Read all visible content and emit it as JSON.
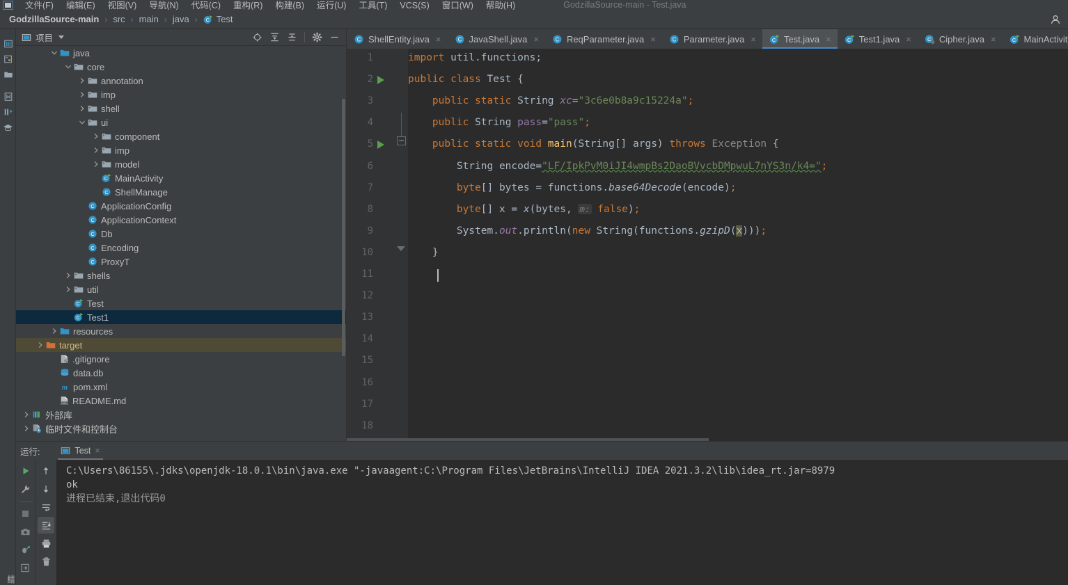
{
  "window": {
    "title": "GodzillaSource-main - Test.java"
  },
  "menubar": {
    "items": [
      "文件(F)",
      "编辑(E)",
      "视图(V)",
      "导航(N)",
      "代码(C)",
      "重构(R)",
      "构建(B)",
      "运行(U)",
      "工具(T)",
      "VCS(S)",
      "窗口(W)",
      "帮助(H)"
    ]
  },
  "breadcrumb": {
    "root": "GodzillaSource-main",
    "items": [
      "src",
      "main",
      "java",
      "Test"
    ],
    "separator": "›"
  },
  "rail": {
    "icons": [
      "project-icon",
      "structure-icon",
      "folder-icon",
      "favorites-icon",
      "build-icon",
      "learn-icon"
    ],
    "vertical_label": "结"
  },
  "project_panel": {
    "title": "项目",
    "toolbar": [
      "locate-icon",
      "expand-all-icon",
      "collapse-all-icon",
      "gear-icon",
      "minimize-icon"
    ],
    "tree": [
      {
        "label": "java",
        "indent": 4,
        "arrow": "down",
        "icon": "folder-source",
        "type": "folder"
      },
      {
        "label": "core",
        "indent": 5,
        "arrow": "down",
        "icon": "folder-pkg",
        "type": "folder"
      },
      {
        "label": "annotation",
        "indent": 6,
        "arrow": "right",
        "icon": "folder-pkg",
        "type": "folder"
      },
      {
        "label": "imp",
        "indent": 6,
        "arrow": "right",
        "icon": "folder-pkg",
        "type": "folder"
      },
      {
        "label": "shell",
        "indent": 6,
        "arrow": "right",
        "icon": "folder-pkg",
        "type": "folder"
      },
      {
        "label": "ui",
        "indent": 6,
        "arrow": "down",
        "icon": "folder-pkg",
        "type": "folder"
      },
      {
        "label": "component",
        "indent": 7,
        "arrow": "right",
        "icon": "folder-pkg",
        "type": "folder"
      },
      {
        "label": "imp",
        "indent": 7,
        "arrow": "right",
        "icon": "folder-pkg",
        "type": "folder"
      },
      {
        "label": "model",
        "indent": 7,
        "arrow": "right",
        "icon": "folder-pkg",
        "type": "folder"
      },
      {
        "label": "MainActivity",
        "indent": 7,
        "arrow": "none",
        "icon": "class-run",
        "type": "class"
      },
      {
        "label": "ShellManage",
        "indent": 7,
        "arrow": "none",
        "icon": "class",
        "type": "class"
      },
      {
        "label": "ApplicationConfig",
        "indent": 6,
        "arrow": "none",
        "icon": "class",
        "type": "class"
      },
      {
        "label": "ApplicationContext",
        "indent": 6,
        "arrow": "none",
        "icon": "class",
        "type": "class"
      },
      {
        "label": "Db",
        "indent": 6,
        "arrow": "none",
        "icon": "class",
        "type": "class"
      },
      {
        "label": "Encoding",
        "indent": 6,
        "arrow": "none",
        "icon": "class",
        "type": "class"
      },
      {
        "label": "ProxyT",
        "indent": 6,
        "arrow": "none",
        "icon": "class",
        "type": "class"
      },
      {
        "label": "shells",
        "indent": 5,
        "arrow": "right",
        "icon": "folder-pkg",
        "type": "folder"
      },
      {
        "label": "util",
        "indent": 5,
        "arrow": "right",
        "icon": "folder-pkg",
        "type": "folder"
      },
      {
        "label": "Test",
        "indent": 5,
        "arrow": "none",
        "icon": "class-run",
        "type": "class"
      },
      {
        "label": "Test1",
        "indent": 5,
        "arrow": "none",
        "icon": "class-run",
        "type": "class",
        "state": "selected"
      },
      {
        "label": "resources",
        "indent": 4,
        "arrow": "right",
        "icon": "folder-source",
        "type": "folder"
      },
      {
        "label": "target",
        "indent": 3,
        "arrow": "right",
        "icon": "folder-target",
        "type": "folder",
        "state": "target"
      },
      {
        "label": ".gitignore",
        "indent": 4,
        "arrow": "none",
        "icon": "gitignore",
        "type": "file"
      },
      {
        "label": "data.db",
        "indent": 4,
        "arrow": "none",
        "icon": "database",
        "type": "file"
      },
      {
        "label": "pom.xml",
        "indent": 4,
        "arrow": "none",
        "icon": "maven",
        "type": "file"
      },
      {
        "label": "README.md",
        "indent": 4,
        "arrow": "none",
        "icon": "markdown",
        "type": "file"
      },
      {
        "label": "外部库",
        "indent": 2,
        "arrow": "right",
        "icon": "libraries",
        "type": "node"
      },
      {
        "label": "临时文件和控制台",
        "indent": 2,
        "arrow": "right",
        "icon": "scratches",
        "type": "node"
      }
    ]
  },
  "editor_tabs": [
    {
      "label": "ShellEntity.java",
      "icon": "java-class",
      "active": false,
      "close": "×"
    },
    {
      "label": "JavaShell.java",
      "icon": "java-class",
      "active": false,
      "close": "×"
    },
    {
      "label": "ReqParameter.java",
      "icon": "java-class",
      "active": false,
      "close": "×"
    },
    {
      "label": "Parameter.java",
      "icon": "java-class",
      "active": false,
      "close": "×"
    },
    {
      "label": "Test.java",
      "icon": "java-runnable",
      "active": true,
      "close": "×"
    },
    {
      "label": "Test1.java",
      "icon": "java-runnable",
      "active": false,
      "close": "×"
    },
    {
      "label": "Cipher.java",
      "icon": "java-class-q",
      "active": false,
      "close": "×"
    },
    {
      "label": "MainActivity.java",
      "icon": "java-runnable",
      "active": false,
      "close": "×"
    }
  ],
  "editor": {
    "line_numbers": [
      "1",
      "2",
      "3",
      "4",
      "5",
      "6",
      "7",
      "8",
      "9",
      "10",
      "11",
      "12",
      "13",
      "14",
      "15",
      "16",
      "17",
      "18"
    ],
    "lines": [
      {
        "n": 1,
        "text": "import util.functions;"
      },
      {
        "n": 2,
        "text": "public class Test {",
        "run_marker": true
      },
      {
        "n": 3,
        "text": "    public static String xc=\"3c6e0b8a9c15224a\";"
      },
      {
        "n": 4,
        "text": "    public String pass=\"pass\";"
      },
      {
        "n": 5,
        "text": "    public static void main(String[] args) throws Exception {",
        "run_marker": true
      },
      {
        "n": 6,
        "text": "        String encode=\"LF/IpkPvM0iJI4wmpBs2DaoBVvcbDMpwuL7nYS3n/k4=\";"
      },
      {
        "n": 7,
        "text": "        byte[] bytes = functions.base64Decode(encode);"
      },
      {
        "n": 8,
        "text": "        byte[] x = x(bytes,  m: false);"
      },
      {
        "n": 9,
        "text": "        System.out.println(new String(functions.gzipD(x)));"
      },
      {
        "n": 10,
        "text": "    }"
      },
      {
        "n": 11,
        "text": ""
      },
      {
        "n": 12,
        "text": ""
      },
      {
        "n": 13,
        "text": ""
      },
      {
        "n": 14,
        "text": ""
      },
      {
        "n": 15,
        "text": ""
      },
      {
        "n": 16,
        "text": ""
      },
      {
        "n": 17,
        "text": ""
      },
      {
        "n": 18,
        "text": ""
      }
    ],
    "strings": {
      "xc_value": "3c6e0b8a9c15224a",
      "pass_value": "pass",
      "encode_value": "LF/IpkPvM0iJI4wmpBs2DaoBVvcbDMpwuL7nYS3n/k4=",
      "param_hint": "m:"
    }
  },
  "run_panel": {
    "label": "运行:",
    "tab": "Test",
    "tab_close": "×",
    "left_buttons": [
      "rerun-icon",
      "wrench-icon",
      "stop-icon",
      "camera-icon",
      "bug-icon",
      "export-icon"
    ],
    "right_buttons": [
      "up-arrow-icon",
      "down-arrow-icon",
      "soft-wrap-icon",
      "scroll-to-end-icon",
      "print-icon",
      "trash-icon"
    ],
    "vertical_label": "结",
    "console": [
      "C:\\Users\\86155\\.jdks\\openjdk-18.0.1\\bin\\java.exe \"-javaagent:C:\\Program Files\\JetBrains\\IntelliJ IDEA 2021.3.2\\lib\\idea_rt.jar=8979",
      "ok",
      "",
      "进程已结束,退出代码0"
    ]
  },
  "colors": {
    "bg": "#3c3f41",
    "editor_bg": "#2b2b2b",
    "accent": "#4a88c7",
    "keyword": "#cc7832",
    "string": "#6a8759",
    "field": "#9876aa",
    "method": "#ffc66d",
    "selection": "#0d293e",
    "target_folder": "#4e4a36"
  }
}
